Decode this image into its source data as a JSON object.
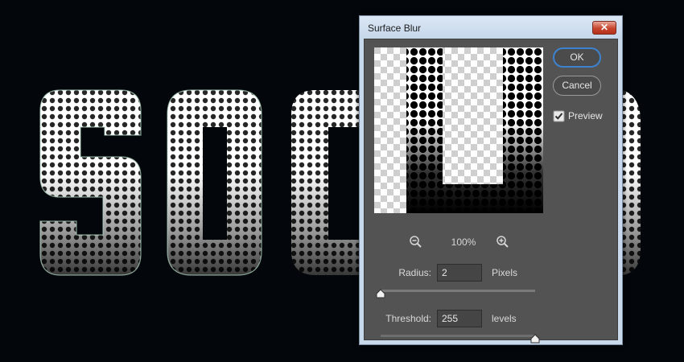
{
  "dialog": {
    "title": "Surface Blur",
    "close_glyph": "✕",
    "ok_label": "OK",
    "cancel_label": "Cancel",
    "preview_label": "Preview",
    "preview_checked": true,
    "zoom_level": "100%",
    "radius": {
      "label": "Radius:",
      "value": "2",
      "unit": "Pixels",
      "slider_fraction": 0.0
    },
    "threshold": {
      "label": "Threshold:",
      "value": "255",
      "unit": "levels",
      "slider_fraction": 1.0
    }
  },
  "icons": [
    "zoom-out-icon",
    "zoom-in-icon",
    "close-icon",
    "checkbox-checked-icon"
  ],
  "colors": {
    "dialog_bg": "#535353",
    "ok_border": "#3d82cf",
    "close_red": "#c8452e"
  }
}
